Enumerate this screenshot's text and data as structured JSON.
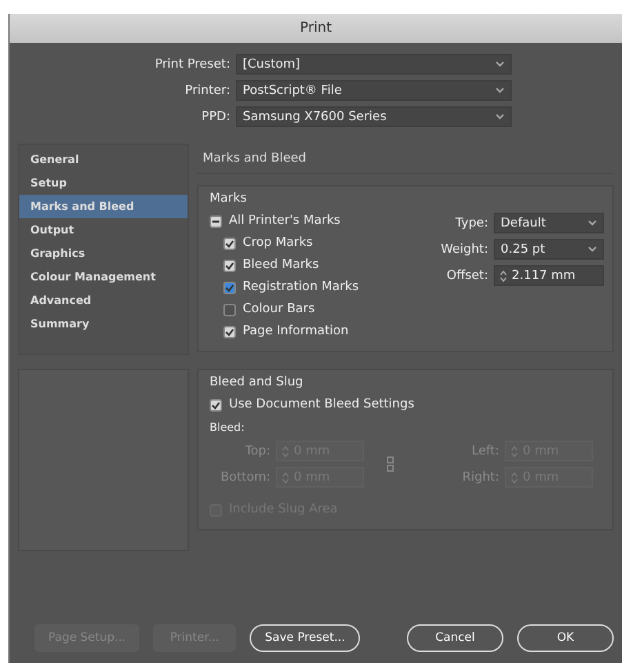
{
  "window": {
    "title": "Print"
  },
  "presets": [
    {
      "label": "Print Preset:",
      "value": "[Custom]"
    },
    {
      "label": "Printer:",
      "value": "PostScript® File"
    },
    {
      "label": "PPD:",
      "value": "Samsung X7600 Series"
    }
  ],
  "sidebar": {
    "items": [
      {
        "label": "General",
        "selected": false
      },
      {
        "label": "Setup",
        "selected": false
      },
      {
        "label": "Marks and Bleed",
        "selected": true
      },
      {
        "label": "Output",
        "selected": false
      },
      {
        "label": "Graphics",
        "selected": false
      },
      {
        "label": "Colour Management",
        "selected": false
      },
      {
        "label": "Advanced",
        "selected": false
      },
      {
        "label": "Summary",
        "selected": false
      }
    ]
  },
  "panel_title": "Marks and Bleed",
  "marks": {
    "title": "Marks",
    "all": {
      "label": "All Printer's Marks",
      "checked": true,
      "mixed": true
    },
    "items": [
      {
        "label": "Crop Marks",
        "checked": true,
        "color": "#d8d8d8"
      },
      {
        "label": "Bleed Marks",
        "checked": true,
        "color": "#d8d8d8"
      },
      {
        "label": "Registration Marks",
        "checked": true,
        "color": "#3f87d8"
      },
      {
        "label": "Colour Bars",
        "checked": false,
        "color": "#505050"
      },
      {
        "label": "Page Information",
        "checked": true,
        "color": "#d8d8d8"
      }
    ],
    "fields": [
      {
        "kind": "select",
        "label": "Type:",
        "value": "Default"
      },
      {
        "kind": "select",
        "label": "Weight:",
        "value": "0.25 pt"
      },
      {
        "kind": "spinner",
        "label": "Offset:",
        "value": "2.117 mm"
      }
    ]
  },
  "bleed": {
    "title": "Bleed and Slug",
    "use_document": {
      "label": "Use Document Bleed Settings",
      "checked": true
    },
    "bleed_label": "Bleed:",
    "fields": [
      {
        "label": "Top:",
        "value": "0 mm",
        "disabled": true
      },
      {
        "label": "Left:",
        "value": "0 mm",
        "disabled": true
      },
      {
        "label": "Bottom:",
        "value": "0 mm",
        "disabled": true
      },
      {
        "label": "Right:",
        "value": "0 mm",
        "disabled": true
      }
    ],
    "slug": {
      "label": "Include Slug Area",
      "checked": false,
      "disabled": true
    }
  },
  "buttons": [
    {
      "label": "Page Setup...",
      "kind": "flat",
      "disabled": true
    },
    {
      "label": "Printer...",
      "kind": "flat",
      "disabled": true
    },
    {
      "label": "Save Preset...",
      "kind": "pill",
      "disabled": false
    },
    {
      "label": "Cancel",
      "kind": "pill",
      "disabled": false
    },
    {
      "label": "OK",
      "kind": "pill",
      "disabled": false
    }
  ]
}
